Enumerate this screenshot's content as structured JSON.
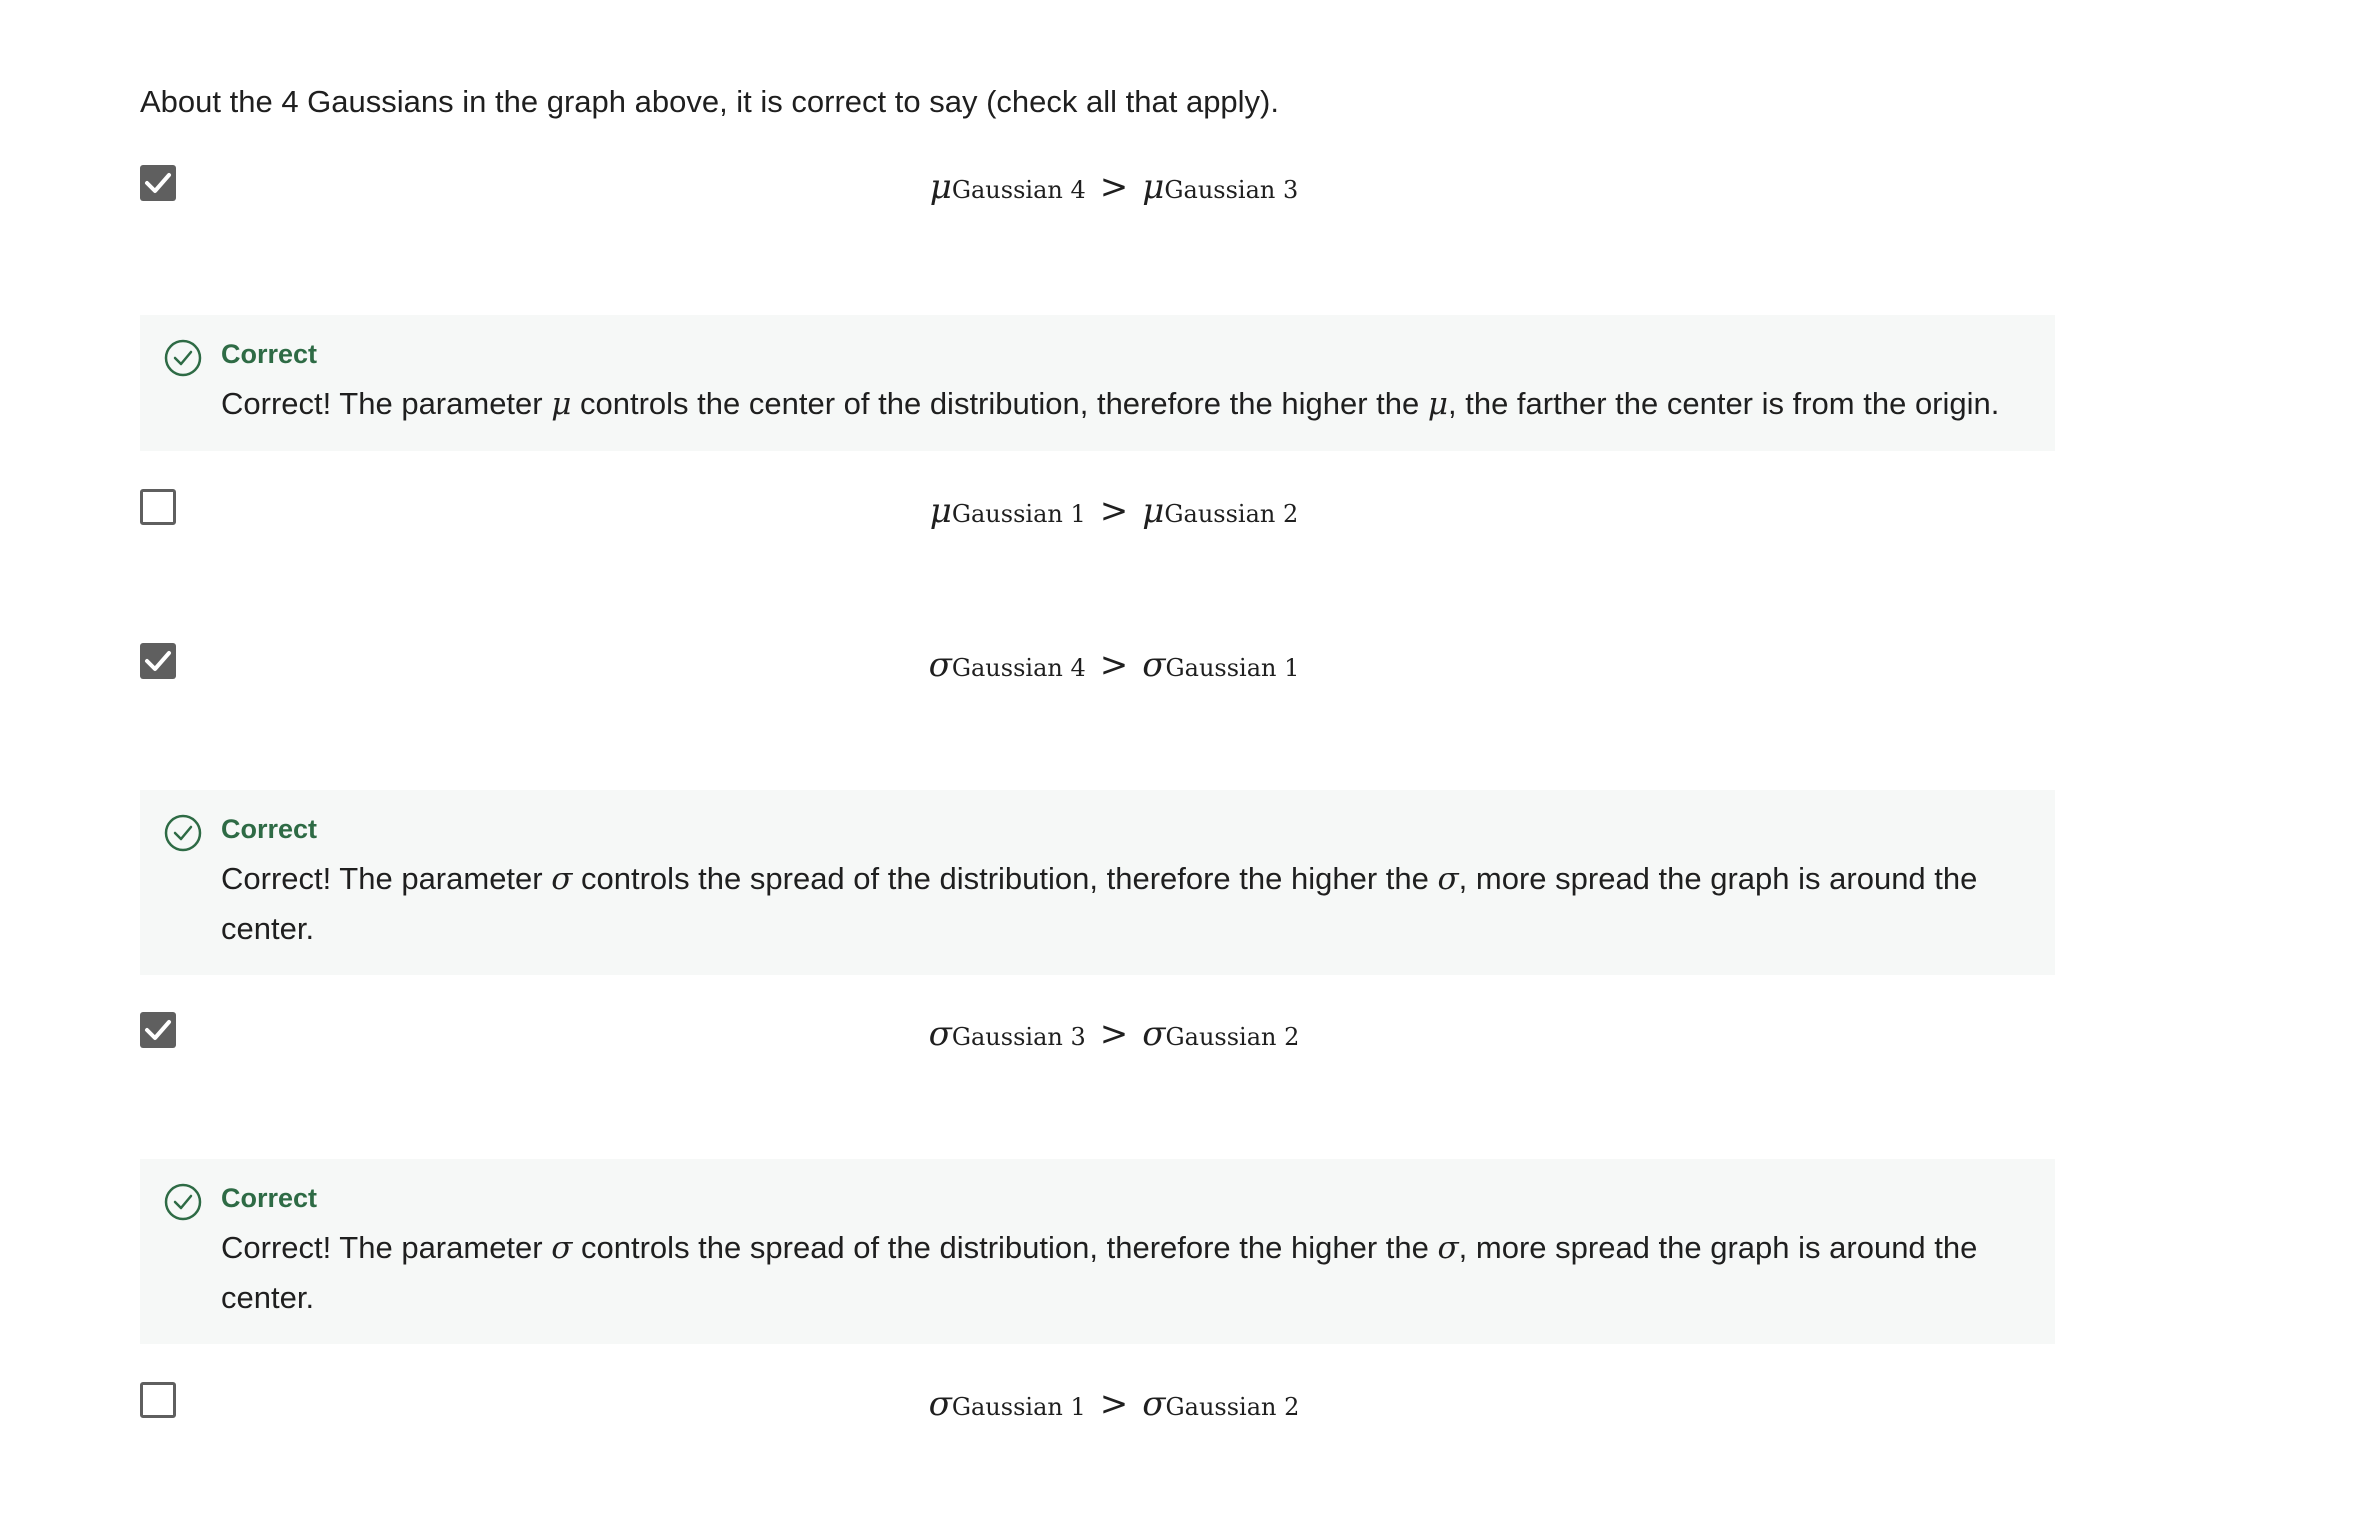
{
  "question": "About the 4 Gaussians in the graph above, it is correct to say (check all that apply).",
  "options": [
    {
      "checked": true,
      "sym": "μ",
      "a": "Gaussian 4",
      "rel": ">",
      "b": "Gaussian 3"
    },
    {
      "checked": false,
      "sym": "μ",
      "a": "Gaussian 1",
      "rel": ">",
      "b": "Gaussian 2"
    },
    {
      "checked": true,
      "sym": "σ",
      "a": "Gaussian 4",
      "rel": ">",
      "b": "Gaussian 1"
    },
    {
      "checked": true,
      "sym": "σ",
      "a": "Gaussian 3",
      "rel": ">",
      "b": "Gaussian 2"
    },
    {
      "checked": false,
      "sym": "σ",
      "a": "Gaussian 1",
      "rel": ">",
      "b": "Gaussian 2"
    }
  ],
  "feedback": [
    {
      "status": "Correct",
      "t1": "Correct! The parameter ",
      "sym1": "μ",
      "t2": " controls the center of the distribution, therefore the higher the ",
      "sym2": "μ",
      "t3": ", the farther the center is from the origin."
    },
    {
      "status": "Correct",
      "t1": "Correct! The parameter ",
      "sym1": "σ",
      "t2": " controls the spread of the distribution, therefore the higher the ",
      "sym2": "σ",
      "t3": ", more spread the graph is around the center."
    },
    {
      "status": "Correct",
      "t1": "Correct! The parameter ",
      "sym1": "σ",
      "t2": " controls the spread of the distribution, therefore the higher the ",
      "sym2": "σ",
      "t3": ", more spread the graph is around the center."
    }
  ],
  "colors": {
    "correct_green": "#2e6b45",
    "checkbox_gray": "#5f5f5f",
    "feedback_bg": "#f6f8f7"
  }
}
